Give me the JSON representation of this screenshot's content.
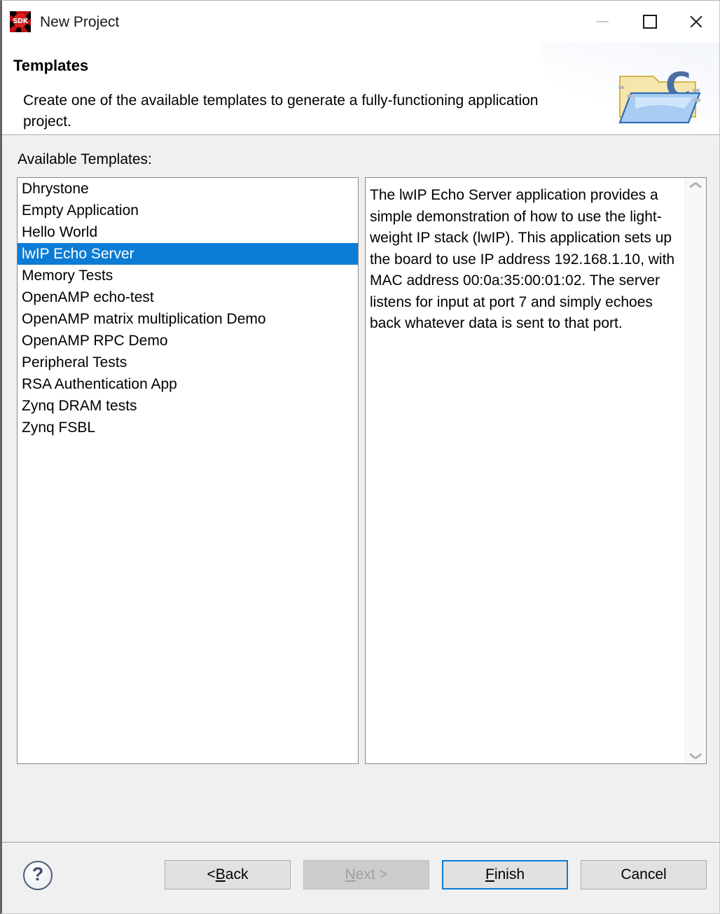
{
  "window": {
    "title": "New Project",
    "icon": "sdk-logo-icon",
    "controls": {
      "minimize": "minimize-icon",
      "maximize": "maximize-icon",
      "close": "close-icon"
    }
  },
  "header": {
    "title": "Templates",
    "description": "Create one of the available templates to generate a fully-functioning application project.",
    "banner_icon": "c-project-folder-icon"
  },
  "body": {
    "available_label": "Available Templates:",
    "templates": [
      {
        "label": "Dhrystone",
        "selected": false
      },
      {
        "label": "Empty Application",
        "selected": false
      },
      {
        "label": "Hello World",
        "selected": false
      },
      {
        "label": "lwIP Echo Server",
        "selected": true
      },
      {
        "label": "Memory Tests",
        "selected": false
      },
      {
        "label": "OpenAMP echo-test",
        "selected": false
      },
      {
        "label": "OpenAMP matrix multiplication Demo",
        "selected": false
      },
      {
        "label": "OpenAMP RPC Demo",
        "selected": false
      },
      {
        "label": "Peripheral Tests",
        "selected": false
      },
      {
        "label": "RSA Authentication App",
        "selected": false
      },
      {
        "label": "Zynq DRAM tests",
        "selected": false
      },
      {
        "label": "Zynq FSBL",
        "selected": false
      }
    ],
    "description_text": "The lwIP Echo Server application provides a simple demonstration of how to use the light-weight IP stack (lwIP). This application sets up the board to use IP address 192.168.1.10, with MAC address 00:0a:35:00:01:02. The server listens for input at port 7 and simply echoes back whatever data is sent to that port.",
    "scroll_up_icon": "chevron-up-icon",
    "scroll_down_icon": "chevron-down-icon"
  },
  "footer": {
    "help": "?",
    "buttons": {
      "back": "< Back",
      "next": "Next >",
      "finish": "Finish",
      "cancel": "Cancel"
    }
  },
  "colors": {
    "selection": "#0c7cd5",
    "dialog_bg": "#f0f0f0",
    "panel_bg": "#ffffff",
    "border": "#828790",
    "default_button_outline": "#0c7cd5"
  }
}
